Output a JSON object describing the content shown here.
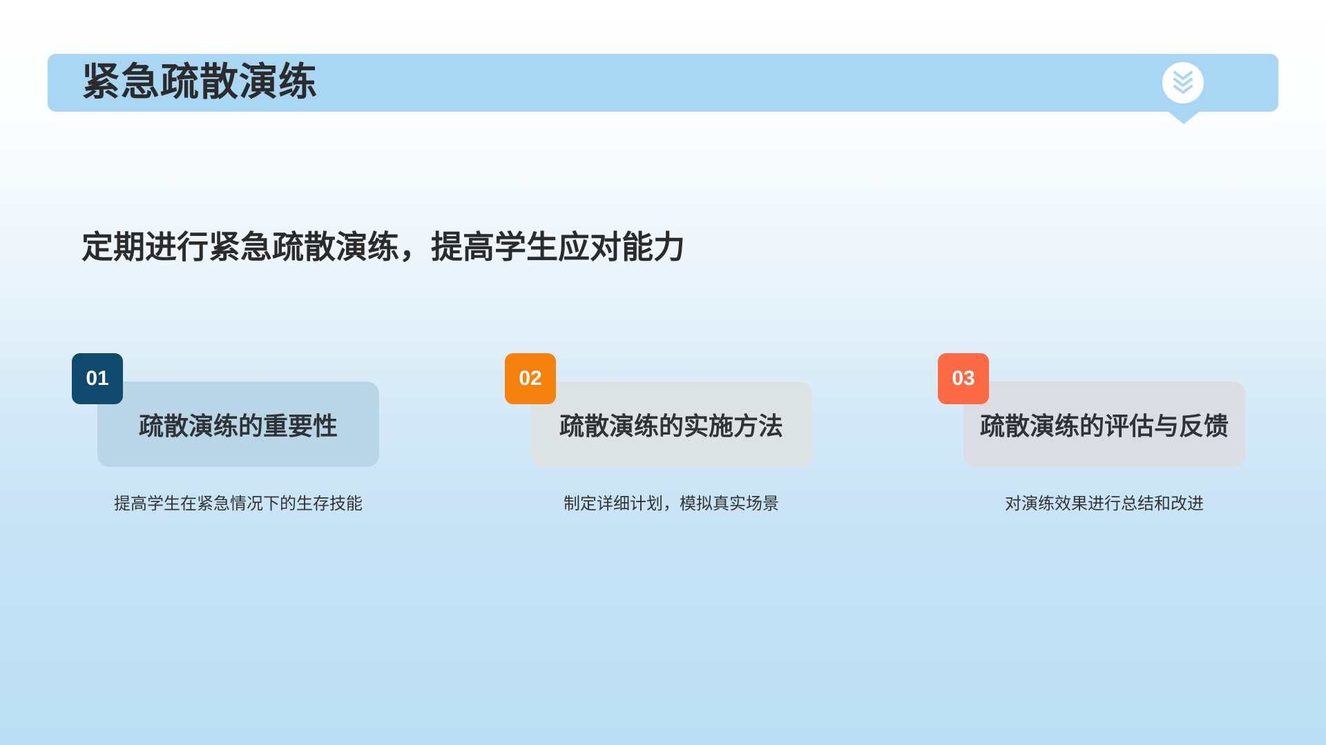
{
  "header": {
    "title": "紧急疏散演练",
    "badge_icon": "chevrons-down-icon",
    "bar_color": "#a9d6f2"
  },
  "subtitle": "定期进行紧急疏散演练，提高学生应对能力",
  "cards": [
    {
      "number": "01",
      "title": "疏散演练的重要性",
      "description": "提高学生在紧急情况下的生存技能",
      "badge_color": "#0f4a6e",
      "card_color": "#b9d6e6"
    },
    {
      "number": "02",
      "title": "疏散演练的实施方法",
      "description": "制定详细计划，模拟真实场景",
      "badge_color": "#f5820f",
      "card_color": "#dde2e3"
    },
    {
      "number": "03",
      "title": "疏散演练的评估与反馈",
      "description": "对演练效果进行总结和改进",
      "badge_color": "#fb6a45",
      "card_color": "#dcdde4"
    }
  ]
}
